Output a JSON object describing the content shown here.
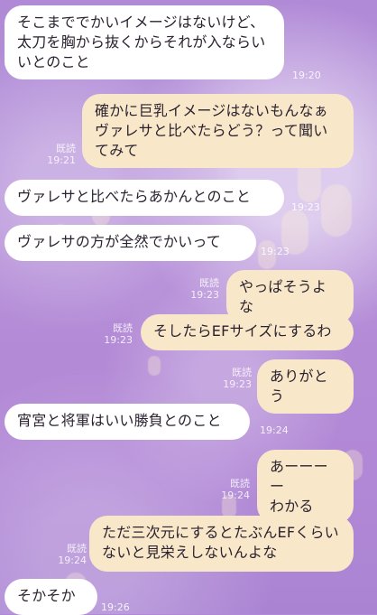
{
  "messages": [
    {
      "side": "incoming",
      "text": "そこまででかいイメージはないけど、太刀を胸から抜くからそれが入ならいいとのこと",
      "time": "19:20",
      "read": ""
    },
    {
      "side": "outgoing",
      "text": "確かに巨乳イメージはないもんなぁ\nヴァレサと比べたらどう？って聞いてみて",
      "time": "19:21",
      "read": "既読"
    },
    {
      "side": "incoming",
      "text": "ヴァレサと比べたらあかんとのこと",
      "time": "19:23",
      "read": ""
    },
    {
      "side": "incoming",
      "text": "ヴァレサの方が全然でかいって",
      "time": "19:23",
      "read": ""
    },
    {
      "side": "outgoing",
      "text": "やっぱそうよな",
      "time": "19:23",
      "read": "既読"
    },
    {
      "side": "outgoing",
      "text": "そしたらEFサイズにするわ",
      "time": "19:23",
      "read": "既読"
    },
    {
      "side": "outgoing",
      "text": "ありがとう",
      "time": "19:23",
      "read": "既読"
    },
    {
      "side": "incoming",
      "text": "宵宮と将軍はいい勝負とのこと",
      "time": "19:24",
      "read": ""
    },
    {
      "side": "outgoing",
      "text": "あーーーー\nわかる",
      "time": "19:24",
      "read": "既読"
    },
    {
      "side": "outgoing",
      "text": "ただ三次元にするとたぶんEFくらいないと見栄えしないんよな",
      "time": "19:24",
      "read": "既読"
    },
    {
      "side": "incoming",
      "text": "そかそか",
      "time": "19:26",
      "read": ""
    }
  ]
}
